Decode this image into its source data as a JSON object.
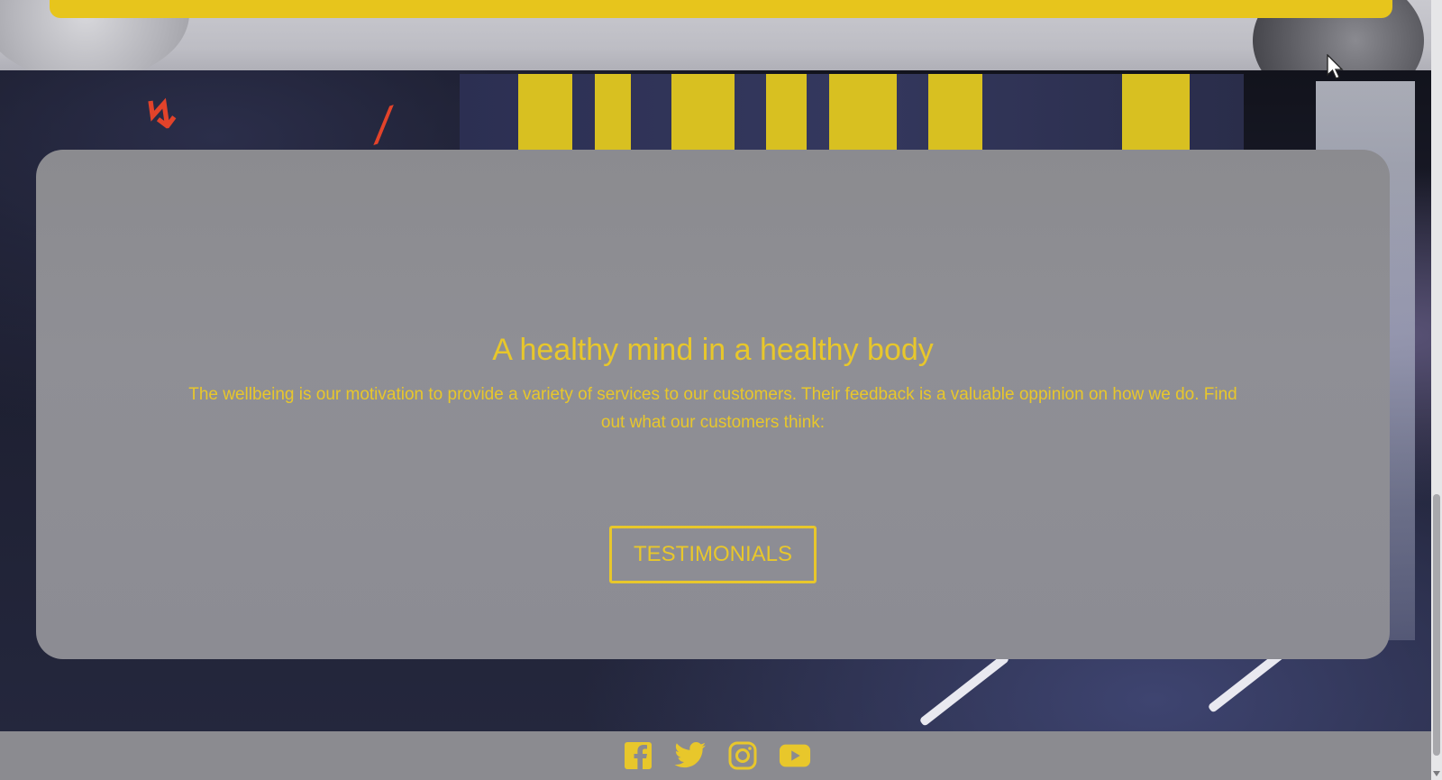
{
  "hero": {
    "title": "A healthy mind in a healthy body",
    "text": "The wellbeing is our motivation to provide a variety of services to our customers. Their feedback is a valuable oppinion on how we do. Find out what our customers think:",
    "button_label": "TESTIMONIALS"
  },
  "footer": {
    "social_links": [
      {
        "name": "facebook-icon"
      },
      {
        "name": "twitter-icon"
      },
      {
        "name": "instagram-icon"
      },
      {
        "name": "youtube-icon"
      }
    ]
  },
  "colors": {
    "accent": "#e8c72b",
    "card_bg": "#8b8b8f",
    "footer_bg": "#8b8b90"
  }
}
